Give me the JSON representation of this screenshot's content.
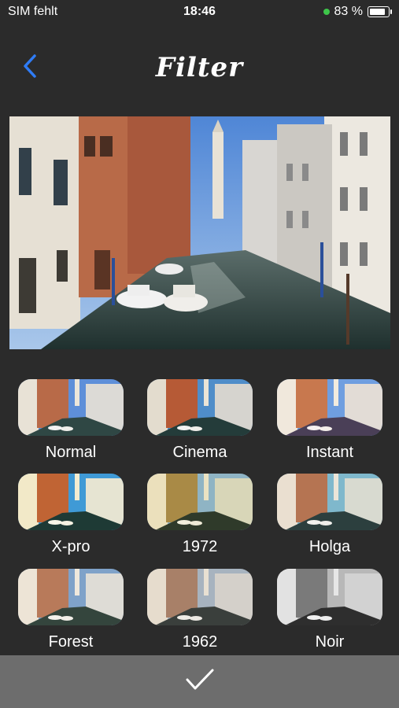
{
  "status_bar": {
    "carrier": "SIM fehlt",
    "time": "18:46",
    "battery": "83 %"
  },
  "header": {
    "title": "Filter",
    "back_icon": "chevron-left-icon"
  },
  "colors": {
    "accent": "#2f7cf6",
    "background": "#2b2b2b",
    "footer": "#6d6d6d"
  },
  "filters": [
    {
      "label": "Normal"
    },
    {
      "label": "Cinema"
    },
    {
      "label": "Instant"
    },
    {
      "label": "X-pro"
    },
    {
      "label": "1972"
    },
    {
      "label": "Holga"
    },
    {
      "label": "Forest"
    },
    {
      "label": "1962"
    },
    {
      "label": "Noir"
    }
  ],
  "footer": {
    "confirm_icon": "checkmark-icon"
  }
}
